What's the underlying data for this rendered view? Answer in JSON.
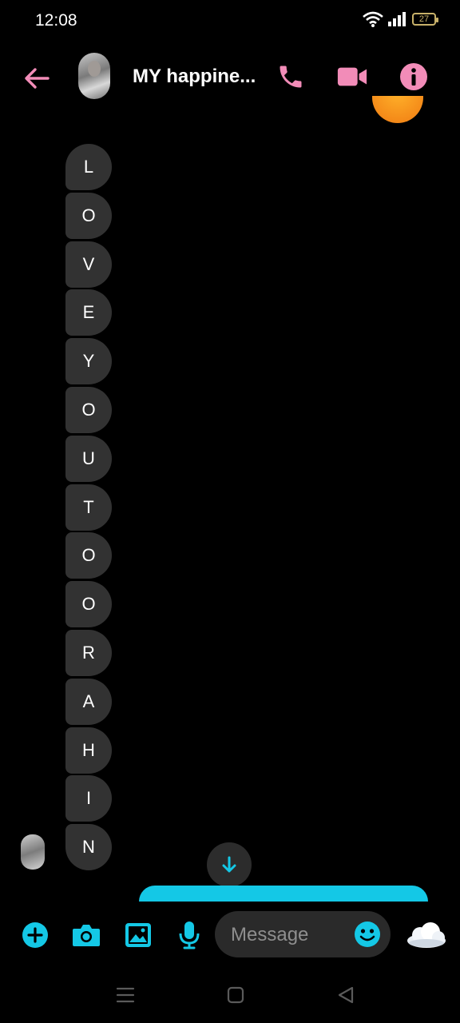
{
  "status_bar": {
    "time": "12:08",
    "battery": "27",
    "icons": [
      "wifi-icon",
      "signal-icon",
      "battery-icon"
    ]
  },
  "header": {
    "contact_name": "MY happine...",
    "icons": [
      "back-arrow-icon",
      "phone-icon",
      "video-camera-icon",
      "info-icon"
    ],
    "accent_color": "#f28cb8"
  },
  "messages": {
    "received_letters": [
      "L",
      "O",
      "V",
      "E",
      "Y",
      "O",
      "U",
      "T",
      "O",
      "O",
      "R",
      "A",
      "H",
      "I",
      "N"
    ],
    "bubble_color": "#323232"
  },
  "composer": {
    "placeholder": "Message",
    "icons": [
      "plus-icon",
      "camera-icon",
      "image-icon",
      "microphone-icon",
      "emoji-icon",
      "cloud-icon"
    ],
    "accent_color": "#14c8e6"
  },
  "nav_bar": {
    "icons": [
      "menu-icon",
      "home-icon",
      "back-icon"
    ]
  }
}
